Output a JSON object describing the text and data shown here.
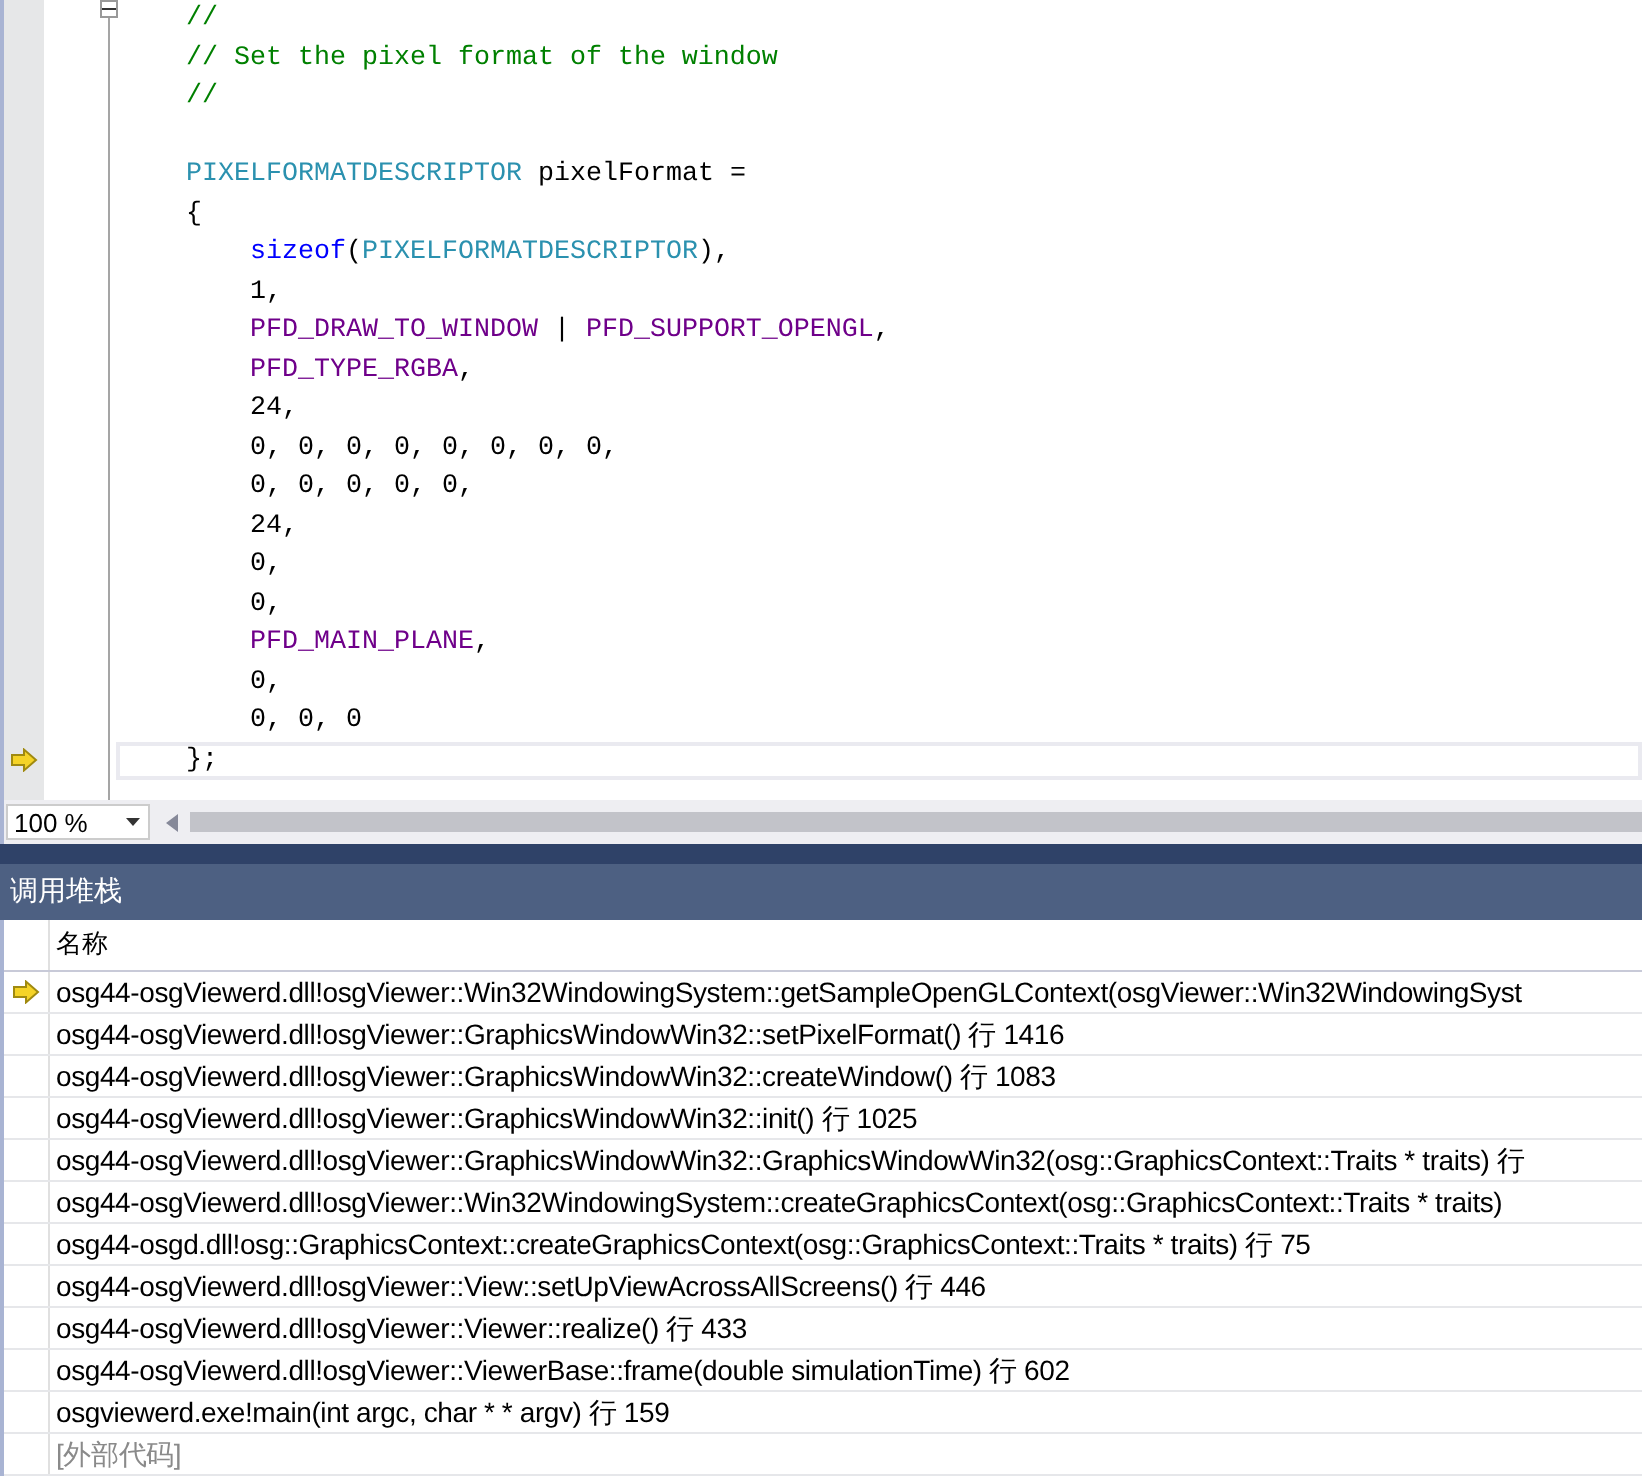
{
  "editor": {
    "lines": [
      {
        "current": false,
        "tokens": [
          {
            "kind": "comment",
            "text": "    //"
          }
        ]
      },
      {
        "current": false,
        "tokens": [
          {
            "kind": "comment",
            "text": "    // Set the pixel format of the window"
          }
        ]
      },
      {
        "current": false,
        "tokens": [
          {
            "kind": "comment",
            "text": "    //"
          }
        ]
      },
      {
        "current": false
      },
      {
        "current": false,
        "tokens": [
          {
            "kind": "type",
            "text": "    PIXELFORMATDESCRIPTOR"
          },
          {
            "kind": "plain",
            "text": " pixelFormat ="
          }
        ]
      },
      {
        "current": false,
        "tokens": [
          {
            "kind": "plain",
            "text": "    {"
          }
        ]
      },
      {
        "current": false,
        "tokens": [
          {
            "kind": "keyword",
            "text": "        sizeof"
          },
          {
            "kind": "plain",
            "text": "("
          },
          {
            "kind": "type",
            "text": "PIXELFORMATDESCRIPTOR"
          },
          {
            "kind": "plain",
            "text": "),"
          }
        ]
      },
      {
        "current": false,
        "tokens": [
          {
            "kind": "plain",
            "text": "        1,"
          }
        ]
      },
      {
        "current": false,
        "tokens": [
          {
            "kind": "macro",
            "text": "        PFD_DRAW_TO_WINDOW"
          },
          {
            "kind": "plain",
            "text": " | "
          },
          {
            "kind": "macro",
            "text": "PFD_SUPPORT_OPENGL"
          },
          {
            "kind": "plain",
            "text": ","
          }
        ]
      },
      {
        "current": false,
        "tokens": [
          {
            "kind": "macro",
            "text": "        PFD_TYPE_RGBA"
          },
          {
            "kind": "plain",
            "text": ","
          }
        ]
      },
      {
        "current": false,
        "tokens": [
          {
            "kind": "plain",
            "text": "        24,"
          }
        ]
      },
      {
        "current": false,
        "tokens": [
          {
            "kind": "plain",
            "text": "        0, 0, 0, 0, 0, 0, 0, 0,"
          }
        ]
      },
      {
        "current": false,
        "tokens": [
          {
            "kind": "plain",
            "text": "        0, 0, 0, 0, 0,"
          }
        ]
      },
      {
        "current": false,
        "tokens": [
          {
            "kind": "plain",
            "text": "        24,"
          }
        ]
      },
      {
        "current": false,
        "tokens": [
          {
            "kind": "plain",
            "text": "        0,"
          }
        ]
      },
      {
        "current": false,
        "tokens": [
          {
            "kind": "plain",
            "text": "        0,"
          }
        ]
      },
      {
        "current": false,
        "tokens": [
          {
            "kind": "macro",
            "text": "        PFD_MAIN_PLANE"
          },
          {
            "kind": "plain",
            "text": ","
          }
        ]
      },
      {
        "current": false,
        "tokens": [
          {
            "kind": "plain",
            "text": "        0,"
          }
        ]
      },
      {
        "current": false,
        "tokens": [
          {
            "kind": "plain",
            "text": "        0, 0, 0"
          }
        ]
      },
      {
        "current": true,
        "tokens": [
          {
            "kind": "plain",
            "text": "    };"
          }
        ]
      }
    ],
    "zoom": "100 %"
  },
  "call_stack": {
    "title": "调用堆栈",
    "columns": [
      "名称"
    ],
    "frames": [
      {
        "kind": "frame",
        "current": true,
        "name": "osg44-osgViewerd.dll!osgViewer::Win32WindowingSystem::getSampleOpenGLContext(osgViewer::Win32WindowingSyst"
      },
      {
        "kind": "frame",
        "current": false,
        "name": "osg44-osgViewerd.dll!osgViewer::GraphicsWindowWin32::setPixelFormat() 行 1416"
      },
      {
        "kind": "frame",
        "current": false,
        "name": "osg44-osgViewerd.dll!osgViewer::GraphicsWindowWin32::createWindow() 行 1083"
      },
      {
        "kind": "frame",
        "current": false,
        "name": "osg44-osgViewerd.dll!osgViewer::GraphicsWindowWin32::init() 行 1025"
      },
      {
        "kind": "frame",
        "current": false,
        "name": "osg44-osgViewerd.dll!osgViewer::GraphicsWindowWin32::GraphicsWindowWin32(osg::GraphicsContext::Traits * traits) 行"
      },
      {
        "kind": "frame",
        "current": false,
        "name": "osg44-osgViewerd.dll!osgViewer::Win32WindowingSystem::createGraphicsContext(osg::GraphicsContext::Traits * traits)"
      },
      {
        "kind": "frame",
        "current": false,
        "name": "osg44-osgd.dll!osg::GraphicsContext::createGraphicsContext(osg::GraphicsContext::Traits * traits) 行 75"
      },
      {
        "kind": "frame",
        "current": false,
        "name": "osg44-osgViewerd.dll!osgViewer::View::setUpViewAcrossAllScreens() 行 446"
      },
      {
        "kind": "frame",
        "current": false,
        "name": "osg44-osgViewerd.dll!osgViewer::Viewer::realize() 行 433"
      },
      {
        "kind": "frame",
        "current": false,
        "name": "osg44-osgViewerd.dll!osgViewer::ViewerBase::frame(double simulationTime) 行 602"
      },
      {
        "kind": "frame",
        "current": false,
        "name": "osgviewerd.exe!main(int argc, char * * argv) 行 159"
      },
      {
        "kind": "external",
        "current": false,
        "name": "[外部代码]"
      }
    ]
  }
}
